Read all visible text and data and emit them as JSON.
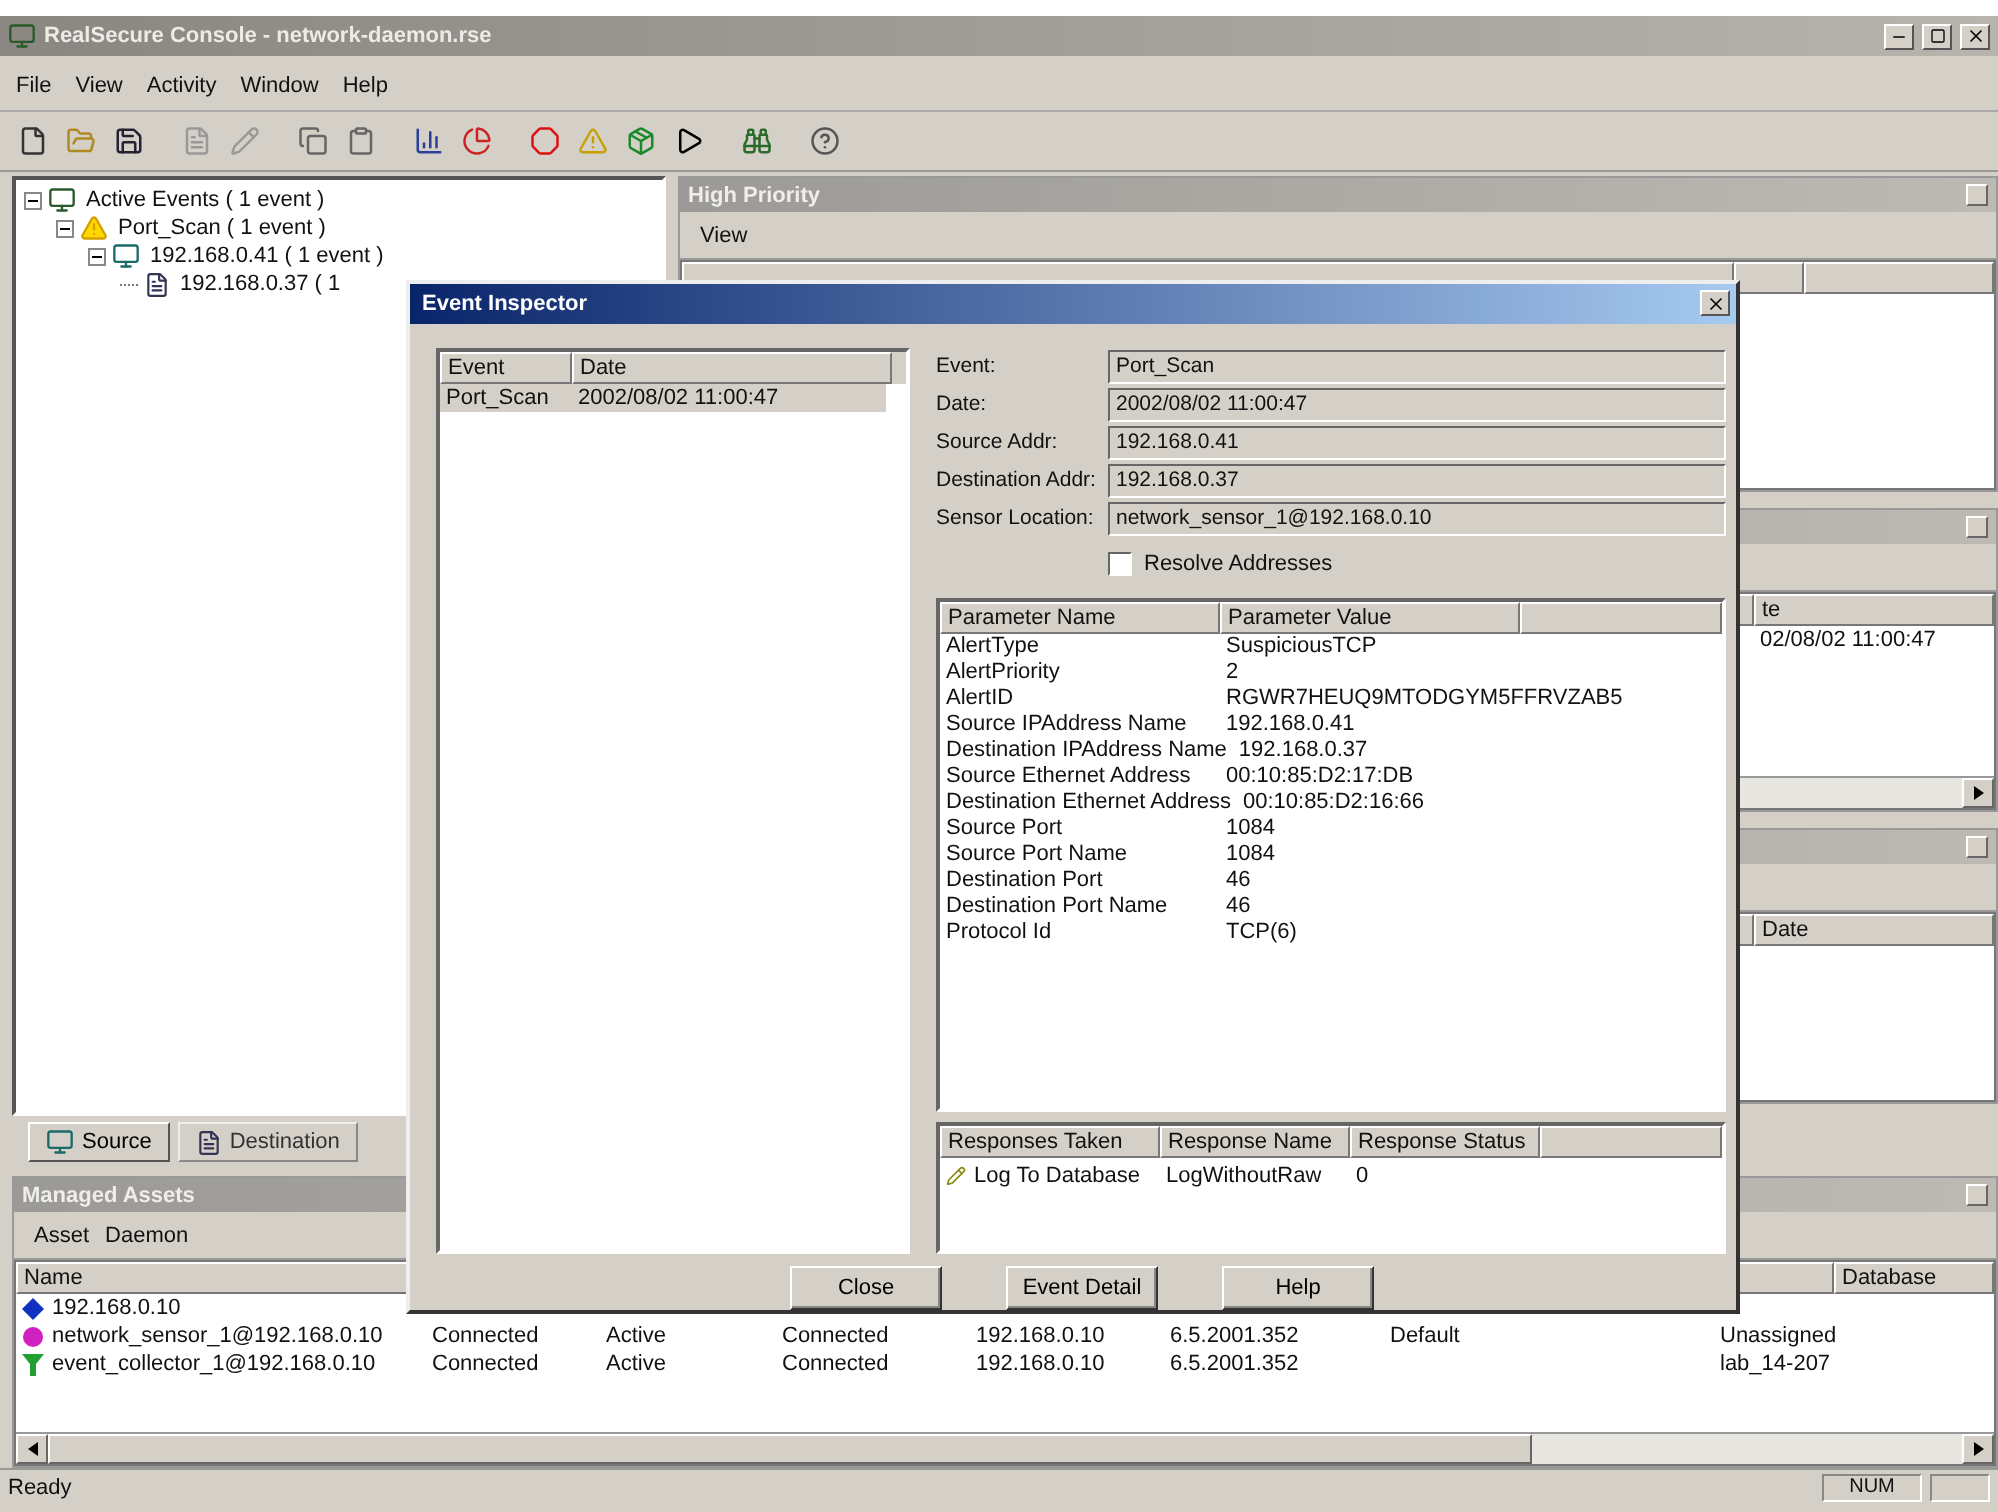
{
  "window": {
    "title": "RealSecure Console - network-daemon.rse"
  },
  "menu": [
    "File",
    "View",
    "Activity",
    "Window",
    "Help"
  ],
  "tree": [
    {
      "label": "Active Events ( 1 event )",
      "kind": "events",
      "expanded": true,
      "children": [
        {
          "label": "Port_Scan ( 1 event )",
          "kind": "alert",
          "expanded": true,
          "children": [
            {
              "label": "192.168.0.41 ( 1 event )",
              "kind": "host",
              "expanded": true,
              "children": [
                {
                  "label": "192.168.0.37 ( 1",
                  "kind": "target"
                }
              ]
            }
          ]
        }
      ]
    }
  ],
  "tree_tabs": [
    {
      "label": "Source",
      "kind": "host",
      "selected": true
    },
    {
      "label": "Destination",
      "kind": "target",
      "selected": false
    }
  ],
  "panels": [
    {
      "caption": "High Priority",
      "menu": [
        "View"
      ]
    },
    {
      "header": [
        "te"
      ],
      "rows": [
        [
          "02/08/02 11:00:47"
        ]
      ],
      "scrollbar": true
    },
    {
      "header": [
        "Date"
      ]
    }
  ],
  "assets": {
    "caption": "Managed Assets",
    "menu": [
      "Asset",
      "Daemon"
    ],
    "name_header": "Name",
    "database_header": "Database",
    "rows": [
      {
        "kind": "host",
        "name": "192.168.0.10"
      },
      {
        "kind": "sensor",
        "name": "network_sensor_1@192.168.0.10",
        "column_2": "Connected",
        "column_3": "Active",
        "column_4": "Connected",
        "column_5": "192.168.0.10",
        "column_6": "6.5.2001.352",
        "column_7": "Default",
        "column_8": "Unassigned"
      },
      {
        "kind": "collector",
        "name": "event_collector_1@192.168.0.10",
        "column_2": "Connected",
        "column_3": "Active",
        "column_4": "Connected",
        "column_5": "192.168.0.10",
        "column_6": "6.5.2001.352",
        "column_8": "lab_14-207"
      }
    ]
  },
  "status_bar": {
    "text": "Ready",
    "indicator": "NUM"
  },
  "dialog": {
    "title": "Event Inspector",
    "events": {
      "columns": [
        "Event",
        "Date"
      ],
      "rows": [
        {
          "cells": [
            "Port_Scan",
            "2002/08/02 11:00:47"
          ],
          "selected": true
        }
      ]
    },
    "fields": [
      {
        "label": "Event:",
        "value": "Port_Scan"
      },
      {
        "label": "Date:",
        "value": "2002/08/02 11:00:47"
      },
      {
        "label": "Source Addr:",
        "value": "192.168.0.41"
      },
      {
        "label": "Destination Addr:",
        "value": "192.168.0.37"
      },
      {
        "label": "Sensor Location:",
        "value": "network_sensor_1@192.168.0.10"
      }
    ],
    "resolve": {
      "label": "Resolve Addresses",
      "checked": false
    },
    "parameters": {
      "columns": [
        "Parameter Name",
        "Parameter Value"
      ],
      "rows": [
        [
          "AlertType",
          "SuspiciousTCP"
        ],
        [
          "AlertPriority",
          "2"
        ],
        [
          "AlertID",
          "RGWR7HEUQ9MTODGYM5FFRVZAB5"
        ],
        [
          "Source IPAddress Name",
          "192.168.0.41"
        ],
        [
          "Destination IPAddress Name",
          "192.168.0.37"
        ],
        [
          "Source Ethernet Address",
          "00:10:85:D2:17:DB"
        ],
        [
          "Destination Ethernet Address",
          "00:10:85:D2:16:66"
        ],
        [
          "Source Port",
          "1084"
        ],
        [
          "Source Port Name",
          "1084"
        ],
        [
          "Destination Port",
          "46"
        ],
        [
          "Destination Port Name",
          "46"
        ],
        [
          "Protocol Id",
          "TCP(6)"
        ]
      ]
    },
    "responses": {
      "columns": [
        "Responses Taken",
        "Response Name",
        "Response Status"
      ],
      "rows": [
        [
          "Log To Database",
          "LogWithoutRaw",
          "0"
        ]
      ]
    },
    "buttons": [
      "Close",
      "Event Detail",
      "Help"
    ]
  }
}
